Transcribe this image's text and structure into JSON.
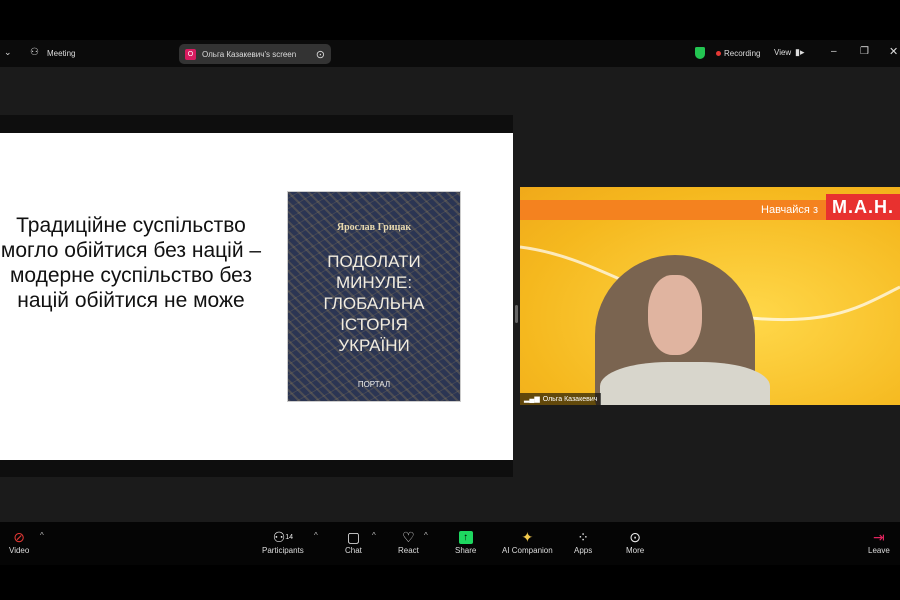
{
  "topbar": {
    "meeting_label": "Meeting",
    "share_initial": "O",
    "share_label": "Ольга Казакевич's screen",
    "recording_label": "Recording",
    "view_label": "View"
  },
  "colors": {
    "recording": "#e53935",
    "shield": "#23c552",
    "share": "#1ed760",
    "leave": "#e0245e",
    "avatar": "#d81b60"
  },
  "slide": {
    "text": "Традиційне суспільство могло обійтися без націй – модерне суспільство без націй обійтися не може",
    "book": {
      "author": "Ярослав Грицак",
      "title": "ПОДОЛАТИ\nМИНУЛЕ:\nГЛОБАЛЬНА\nІСТОРІЯ\nУКРАЇНИ",
      "publisher": "ПОРТАЛ"
    }
  },
  "video": {
    "banner_text": "Навчайся з",
    "logo": "М.А.Н.",
    "participant_name": "Ольга Казакевич"
  },
  "toolbar": {
    "video": "Video",
    "participants": "Participants",
    "participants_count": "14",
    "chat": "Chat",
    "react": "React",
    "share": "Share",
    "ai": "AI Companion",
    "apps": "Apps",
    "more": "More",
    "leave": "Leave"
  }
}
